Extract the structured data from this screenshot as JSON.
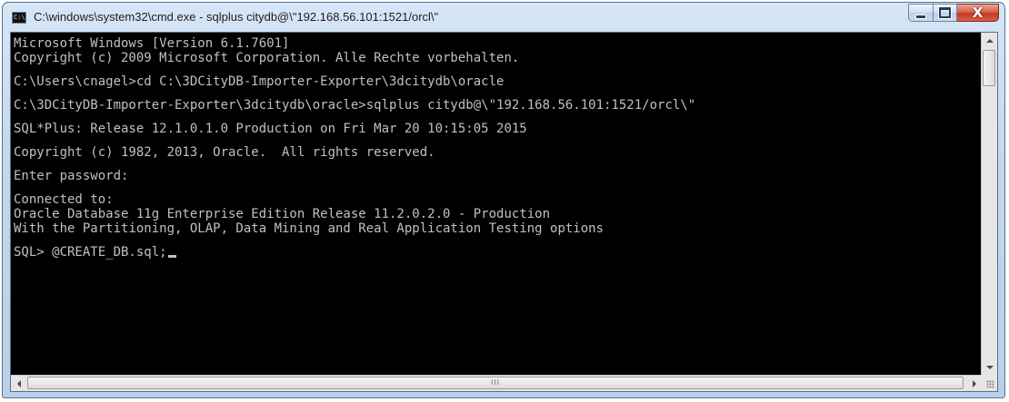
{
  "window": {
    "title": "C:\\windows\\system32\\cmd.exe - sqlplus  citydb@\\\"192.168.56.101:1521/orcl\\\"",
    "icon": "cmd-prompt-icon"
  },
  "controls": {
    "minimize": "minimize-icon",
    "maximize": "maximize-icon",
    "close": "close-icon",
    "close_glyph": "X"
  },
  "console": {
    "lines": [
      "Microsoft Windows [Version 6.1.7601]",
      "Copyright (c) 2009 Microsoft Corporation. Alle Rechte vorbehalten.",
      "",
      "C:\\Users\\cnagel>cd C:\\3DCityDB-Importer-Exporter\\3dcitydb\\oracle",
      "",
      "C:\\3DCityDB-Importer-Exporter\\3dcitydb\\oracle>sqlplus citydb@\\\"192.168.56.101:1521/orcl\\\"",
      "",
      "SQL*Plus: Release 12.1.0.1.0 Production on Fri Mar 20 10:15:05 2015",
      "",
      "Copyright (c) 1982, 2013, Oracle.  All rights reserved.",
      "",
      "Enter password:",
      "",
      "Connected to:",
      "Oracle Database 11g Enterprise Edition Release 11.2.0.2.0 - Production",
      "With the Partitioning, OLAP, Data Mining and Real Application Testing options",
      "",
      "SQL> @CREATE_DB.sql;"
    ]
  },
  "scrollbars": {
    "vertical_position": 0.0,
    "horizontal_position": 0.0,
    "grip": "III"
  },
  "colors": {
    "console_bg": "#000000",
    "console_fg": "#c0c0c0",
    "close_button": "#c9432a"
  }
}
